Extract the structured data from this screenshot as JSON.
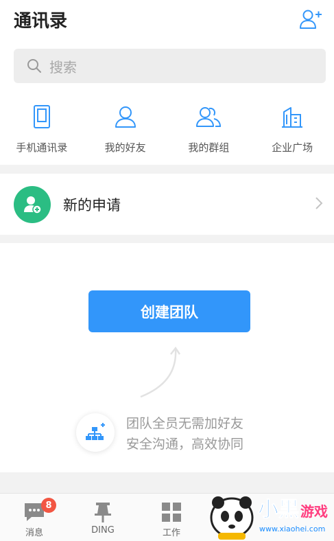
{
  "header": {
    "title": "通讯录"
  },
  "search": {
    "placeholder": "搜索"
  },
  "quick_links": [
    {
      "label": "手机通讯录",
      "icon": "phone-icon"
    },
    {
      "label": "我的好友",
      "icon": "person-icon"
    },
    {
      "label": "我的群组",
      "icon": "group-icon"
    },
    {
      "label": "企业广场",
      "icon": "building-icon"
    }
  ],
  "new_request": {
    "label": "新的申请"
  },
  "team": {
    "create_label": "创建团队",
    "line1": "团队全员无需加好友",
    "line2": "安全沟通，高效协同"
  },
  "tabbar": {
    "tabs": [
      {
        "label": "消息",
        "badge": "8"
      },
      {
        "label": "DING"
      },
      {
        "label": "工作"
      }
    ]
  },
  "watermark": {
    "text": "小黑游戏",
    "url": "www.xiaohei.com"
  },
  "colors": {
    "accent": "#3296fa",
    "green": "#2bbd83",
    "badge": "#f25643"
  }
}
